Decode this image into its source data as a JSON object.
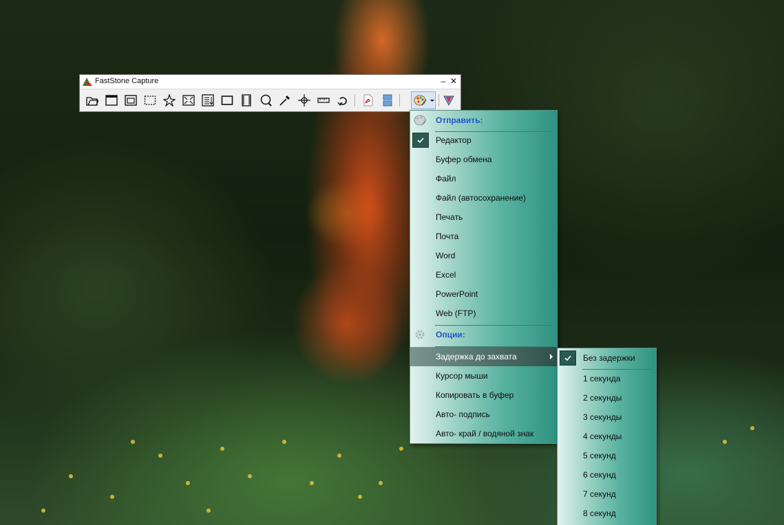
{
  "window": {
    "title": "FastStone Capture",
    "minimize_glyph": "–",
    "close_glyph": "✕"
  },
  "toolbar": {
    "tools": [
      {
        "name": "open-file-icon"
      },
      {
        "name": "capture-window-icon"
      },
      {
        "name": "capture-object-icon"
      },
      {
        "name": "capture-rectangle-icon"
      },
      {
        "name": "capture-freehand-icon"
      },
      {
        "name": "capture-fullscreen-icon"
      },
      {
        "name": "capture-scrolling-icon"
      },
      {
        "name": "capture-fixed-region-icon"
      },
      {
        "name": "screen-recorder-icon"
      },
      {
        "name": "magnifier-icon"
      },
      {
        "name": "color-picker-icon"
      },
      {
        "name": "crosshair-icon"
      },
      {
        "name": "ruler-icon"
      },
      {
        "name": "undo-icon"
      },
      {
        "name": "pdf-icon"
      },
      {
        "name": "combine-icon"
      },
      {
        "name": "output-editor-icon"
      },
      {
        "name": "settings-icon"
      }
    ]
  },
  "main_menu": {
    "send_header": "Отправить:",
    "send_items": [
      "Редактор",
      "Буфер обмена",
      "Файл",
      "Файл (автосохранение)",
      "Печать",
      "Почта",
      "Word",
      "Excel",
      "PowerPoint",
      "Web (FTP)"
    ],
    "checked_item": "Редактор",
    "options_header": "Опции:",
    "option_items": [
      "Задержка до захвата",
      "Курсор мыши",
      "Копировать в буфер",
      "Авто- подпись",
      "Авто- край / водяной знак"
    ],
    "highlighted_item": "Задержка до захвата"
  },
  "delay_submenu": {
    "items": [
      "Без задержки",
      "1 секунда",
      "2 секунды",
      "3 секунды",
      "4 секунды",
      "5 секунд",
      "6 секунд",
      "7 секунд",
      "8 секунд"
    ],
    "checked_item": "Без задержки"
  },
  "colors": {
    "menu_header": "#1f57c8",
    "menu_gradient_end": "#2f9280",
    "highlight": "#2f4f49"
  }
}
